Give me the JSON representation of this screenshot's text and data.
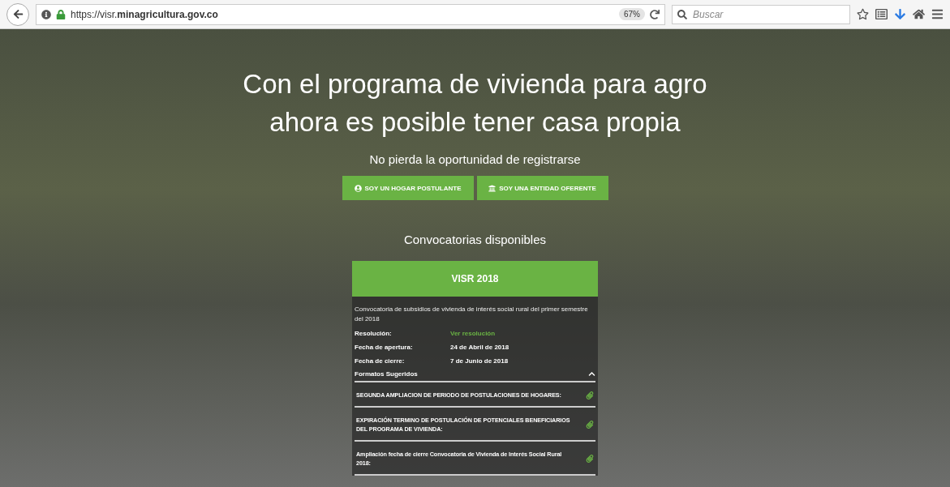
{
  "browser": {
    "url": "https://visr.**minagricultura.gov.co**",
    "zoom": "67%",
    "search": {
      "placeholder": "Buscar"
    }
  },
  "hero": {
    "title_lines": [
      "Con el programa de vivienda para agro",
      "ahora es posible tener casa propia"
    ],
    "subtitle": "No pierda la oportunidad de registrarse",
    "buttons": [
      {
        "label": "SOY UN HOGAR POSTULANTE",
        "kind": "person"
      },
      {
        "label": "SOY UNA ENTIDAD OFERENTE",
        "kind": "institution"
      }
    ],
    "section_title": "Convocatorias disponibles",
    "call": {
      "name": "VISR 2018",
      "description": "Convocatoria de subsidios de vivienda de interés social rural del primer semestre del 2018",
      "details": [
        {
          "label": "Resolución:",
          "value": "Ver resolución",
          "kind": "link"
        },
        {
          "label": "Fecha de apertura:",
          "value": "24 de Abril de 2018",
          "kind": "text"
        },
        {
          "label": "Fecha de cierre:",
          "value": "7 de Junio de 2018",
          "kind": "text"
        }
      ],
      "formats": {
        "title": "Formatos Sugeridos",
        "expanded": true,
        "items": [
          "SEGUNDA AMPLIACION DE PERIODO DE POSTULACIONES DE HOGARES:",
          "EXPIRACIÓN TERMINO DE POSTULACIÓN DE POTENCIALES BENEFICIARIOS DEL PROGRAMA DE VIVIENDA:",
          "Ampliación fecha de cierre Convocatoria de Vivienda de Interés Social Rural 2018:"
        ]
      }
    }
  }
}
